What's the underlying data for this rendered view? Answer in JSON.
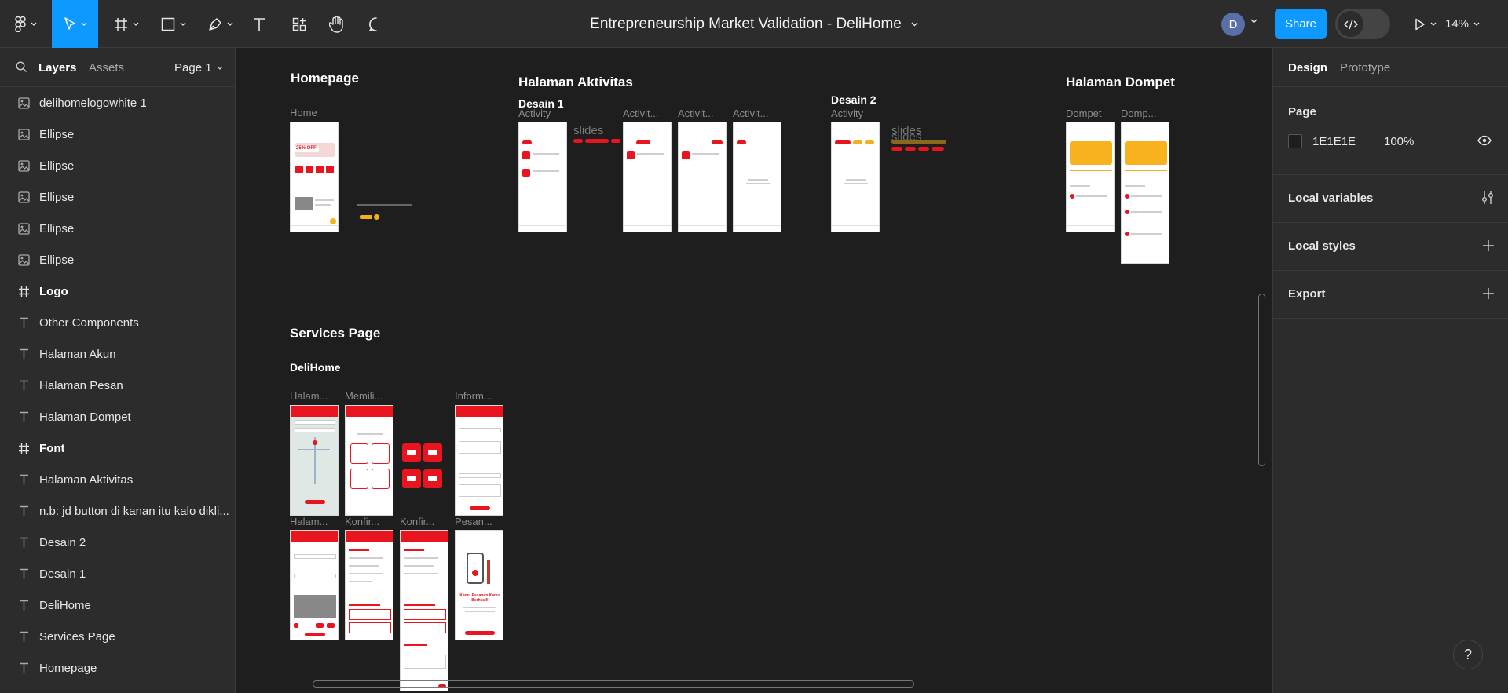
{
  "toolbar": {
    "file_title": "Entrepreneurship Market Validation - DeliHome",
    "avatar_initial": "D",
    "share_label": "Share",
    "zoom_level": "14%"
  },
  "left_panel": {
    "tab_layers": "Layers",
    "tab_assets": "Assets",
    "page_selector": "Page 1",
    "layers": [
      {
        "name": "delihomelogowhite 1",
        "icon": "image-icon"
      },
      {
        "name": "Ellipse",
        "icon": "image-icon"
      },
      {
        "name": "Ellipse",
        "icon": "image-icon"
      },
      {
        "name": "Ellipse",
        "icon": "image-icon"
      },
      {
        "name": "Ellipse",
        "icon": "image-icon"
      },
      {
        "name": "Ellipse",
        "icon": "image-icon"
      },
      {
        "name": "Logo",
        "icon": "frame-icon"
      },
      {
        "name": "Other Components",
        "icon": "text-icon"
      },
      {
        "name": "Halaman Akun",
        "icon": "text-icon"
      },
      {
        "name": "Halaman Pesan",
        "icon": "text-icon"
      },
      {
        "name": "Halaman Dompet",
        "icon": "text-icon"
      },
      {
        "name": "Font",
        "icon": "frame-icon"
      },
      {
        "name": "Halaman Aktivitas",
        "icon": "text-icon"
      },
      {
        "name": "n.b: jd button di kanan itu kalo dikli...",
        "icon": "text-icon"
      },
      {
        "name": "Desain 2",
        "icon": "text-icon"
      },
      {
        "name": "Desain 1",
        "icon": "text-icon"
      },
      {
        "name": "DeliHome",
        "icon": "text-icon"
      },
      {
        "name": "Services Page",
        "icon": "text-icon"
      },
      {
        "name": "Homepage",
        "icon": "text-icon"
      }
    ]
  },
  "right_panel": {
    "tab_design": "Design",
    "tab_prototype": "Prototype",
    "page_title": "Page",
    "page_color": "1E1E1E",
    "page_opacity": "100%",
    "local_variables": "Local variables",
    "local_styles": "Local styles",
    "export": "Export"
  },
  "canvas": {
    "homepage": "Homepage",
    "home": "Home",
    "halaman_aktivitas": "Halaman Aktivitas",
    "desain1": "Desain 1",
    "activity": "Activity",
    "slides": "slides",
    "activit_trunc": "Activit...",
    "desain2": "Desain 2",
    "halaman_dompet": "Halaman Dompet",
    "dompet": "Dompet",
    "domp_trunc": "Domp...",
    "services_page": "Services Page",
    "delihome": "DeliHome",
    "halam_trunc": "Halam...",
    "memili_trunc": "Memili...",
    "inform_trunc": "Inform...",
    "konfir_trunc": "Konfir...",
    "pesan_trunc": "Pesan...",
    "promo_text": "25% OFF",
    "sukses_text": "Kamu Pesanan Kamu Berhasil!"
  },
  "help_label": "?"
}
